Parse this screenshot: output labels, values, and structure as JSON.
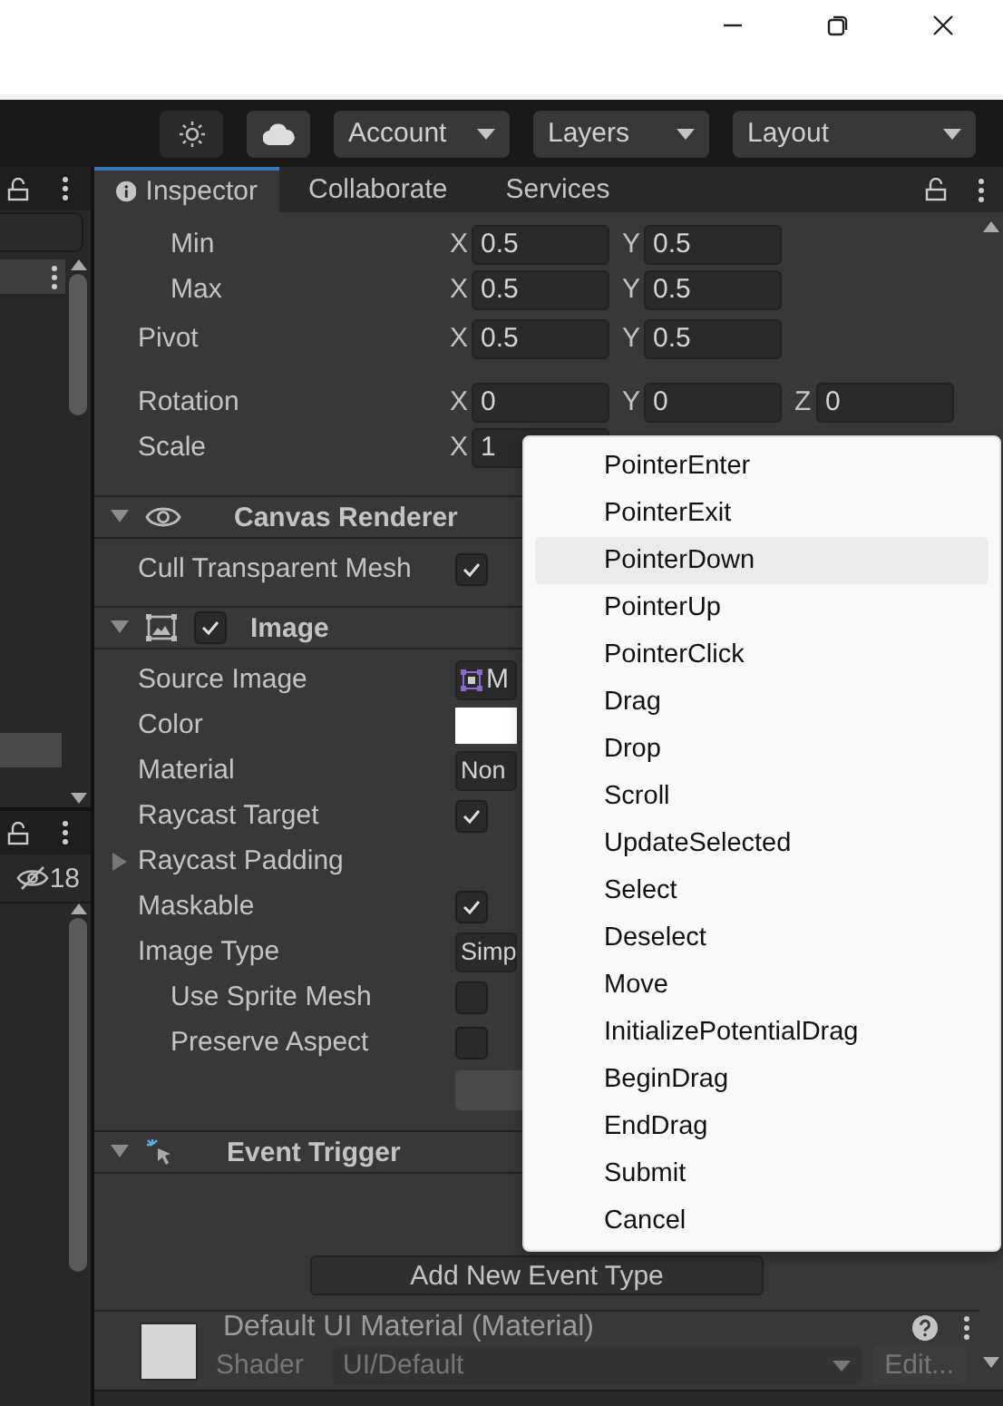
{
  "toolbar": {
    "dropdowns": [
      {
        "label": "Account"
      },
      {
        "label": "Layers"
      },
      {
        "label": "Layout"
      }
    ]
  },
  "hierarchy": {
    "hidden_count": "18"
  },
  "inspector": {
    "tabs": [
      {
        "label": "Inspector",
        "selected": true
      },
      {
        "label": "Collaborate",
        "selected": false
      },
      {
        "label": "Services",
        "selected": false
      }
    ],
    "transform_rows": [
      {
        "label": "Min",
        "kind": "sub",
        "fields": [
          {
            "axis": "X",
            "value": "0.5"
          },
          {
            "axis": "Y",
            "value": "0.5"
          }
        ]
      },
      {
        "label": "Max",
        "kind": "sub",
        "fields": [
          {
            "axis": "X",
            "value": "0.5"
          },
          {
            "axis": "Y",
            "value": "0.5"
          }
        ]
      },
      {
        "label": "Pivot",
        "kind": "main",
        "fields": [
          {
            "axis": "X",
            "value": "0.5"
          },
          {
            "axis": "Y",
            "value": "0.5"
          }
        ]
      },
      {
        "label": "Rotation",
        "kind": "main",
        "fields": [
          {
            "axis": "X",
            "value": "0"
          },
          {
            "axis": "Y",
            "value": "0"
          },
          {
            "axis": "Z",
            "value": "0"
          }
        ]
      },
      {
        "label": "Scale",
        "kind": "main",
        "fields": [
          {
            "axis": "X",
            "value": "1"
          }
        ]
      }
    ],
    "components": [
      {
        "title": "Canvas Renderer",
        "kind": "renderer",
        "expanded": true,
        "properties": [
          {
            "label": "Cull Transparent Mesh",
            "kind": "checkbox",
            "checked": true
          }
        ]
      },
      {
        "title": "Image",
        "kind": "image",
        "expanded": true,
        "enabled": true,
        "properties": [
          {
            "label": "Source Image",
            "kind": "object",
            "value": "M"
          },
          {
            "label": "Color",
            "kind": "color",
            "color": "#ffffff"
          },
          {
            "label": "Material",
            "kind": "dropdown",
            "value": "Non"
          },
          {
            "label": "Raycast Target",
            "kind": "checkbox",
            "checked": true
          },
          {
            "label": "Raycast Padding",
            "kind": "foldout",
            "expanded": false
          },
          {
            "label": "Maskable",
            "kind": "checkbox",
            "checked": true
          },
          {
            "label": "Image Type",
            "kind": "dropdown",
            "value": "Simp"
          },
          {
            "label": "Use Sprite Mesh",
            "kind": "checkbox",
            "checked": false,
            "sub": true
          },
          {
            "label": "Preserve Aspect",
            "kind": "checkbox",
            "checked": false,
            "sub": true
          },
          {
            "kind": "button"
          }
        ]
      },
      {
        "title": "Event Trigger",
        "kind": "trigger",
        "expanded": true,
        "button": "Add New Event Type"
      }
    ],
    "material": {
      "name": "Default UI Material (Material)",
      "shader_label": "Shader",
      "shader": "UI/Default",
      "edit": "Edit..."
    }
  },
  "menu": {
    "items": [
      {
        "label": "PointerEnter",
        "selected": false
      },
      {
        "label": "PointerExit",
        "selected": false
      },
      {
        "label": "PointerDown",
        "selected": true
      },
      {
        "label": "PointerUp",
        "selected": false
      },
      {
        "label": "PointerClick",
        "selected": false
      },
      {
        "label": "Drag",
        "selected": false
      },
      {
        "label": "Drop",
        "selected": false
      },
      {
        "label": "Scroll",
        "selected": false
      },
      {
        "label": "UpdateSelected",
        "selected": false
      },
      {
        "label": "Select",
        "selected": false
      },
      {
        "label": "Deselect",
        "selected": false
      },
      {
        "label": "Move",
        "selected": false
      },
      {
        "label": "InitializePotentialDrag",
        "selected": false
      },
      {
        "label": "BeginDrag",
        "selected": false
      },
      {
        "label": "EndDrag",
        "selected": false
      },
      {
        "label": "Submit",
        "selected": false
      },
      {
        "label": "Cancel",
        "selected": false
      }
    ]
  }
}
